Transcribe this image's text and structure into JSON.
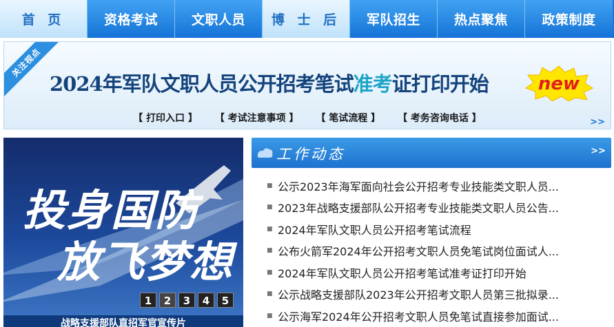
{
  "nav": {
    "items": [
      {
        "label": "首 页"
      },
      {
        "label": "资格考试"
      },
      {
        "label": "文职人员"
      },
      {
        "label": "博 士 后"
      },
      {
        "label": "军队招生"
      },
      {
        "label": "热点聚焦"
      },
      {
        "label": "政策制度"
      }
    ]
  },
  "banner": {
    "ribbon": "关注视点",
    "headline_a": "2024年军队文职人员公开招考笔试",
    "headline_b": "准考",
    "headline_c": "证打印开始",
    "badge": "new",
    "links": [
      "打印入口",
      "考试注意事项",
      "笔试流程",
      "考务咨询电话"
    ],
    "more": ">>"
  },
  "slideshow": {
    "line1": "投身国防",
    "line2": "放飞梦想",
    "pages": [
      "1",
      "2",
      "3",
      "4",
      "5"
    ],
    "caption": "战略支援部队直招军官宣传片"
  },
  "news": {
    "title": "工作动态",
    "more": ">>",
    "items": [
      "公示2023年海军面向社会公开招考专业技能类文职人员...",
      "2023年战略支援部队公开招考专业技能类文职人员公告...",
      "2024年军队文职人员公开招考笔试流程",
      "公布火箭军2024年公开招考文职人员免笔试岗位面试人...",
      "2024年军队文职人员公开招考笔试准考证打印开始",
      "公示战略支援部队2023年公开招考文职人员第三批拟录...",
      "公示海军2024年公开招考文职人员免笔试直接参加面试..."
    ]
  }
}
